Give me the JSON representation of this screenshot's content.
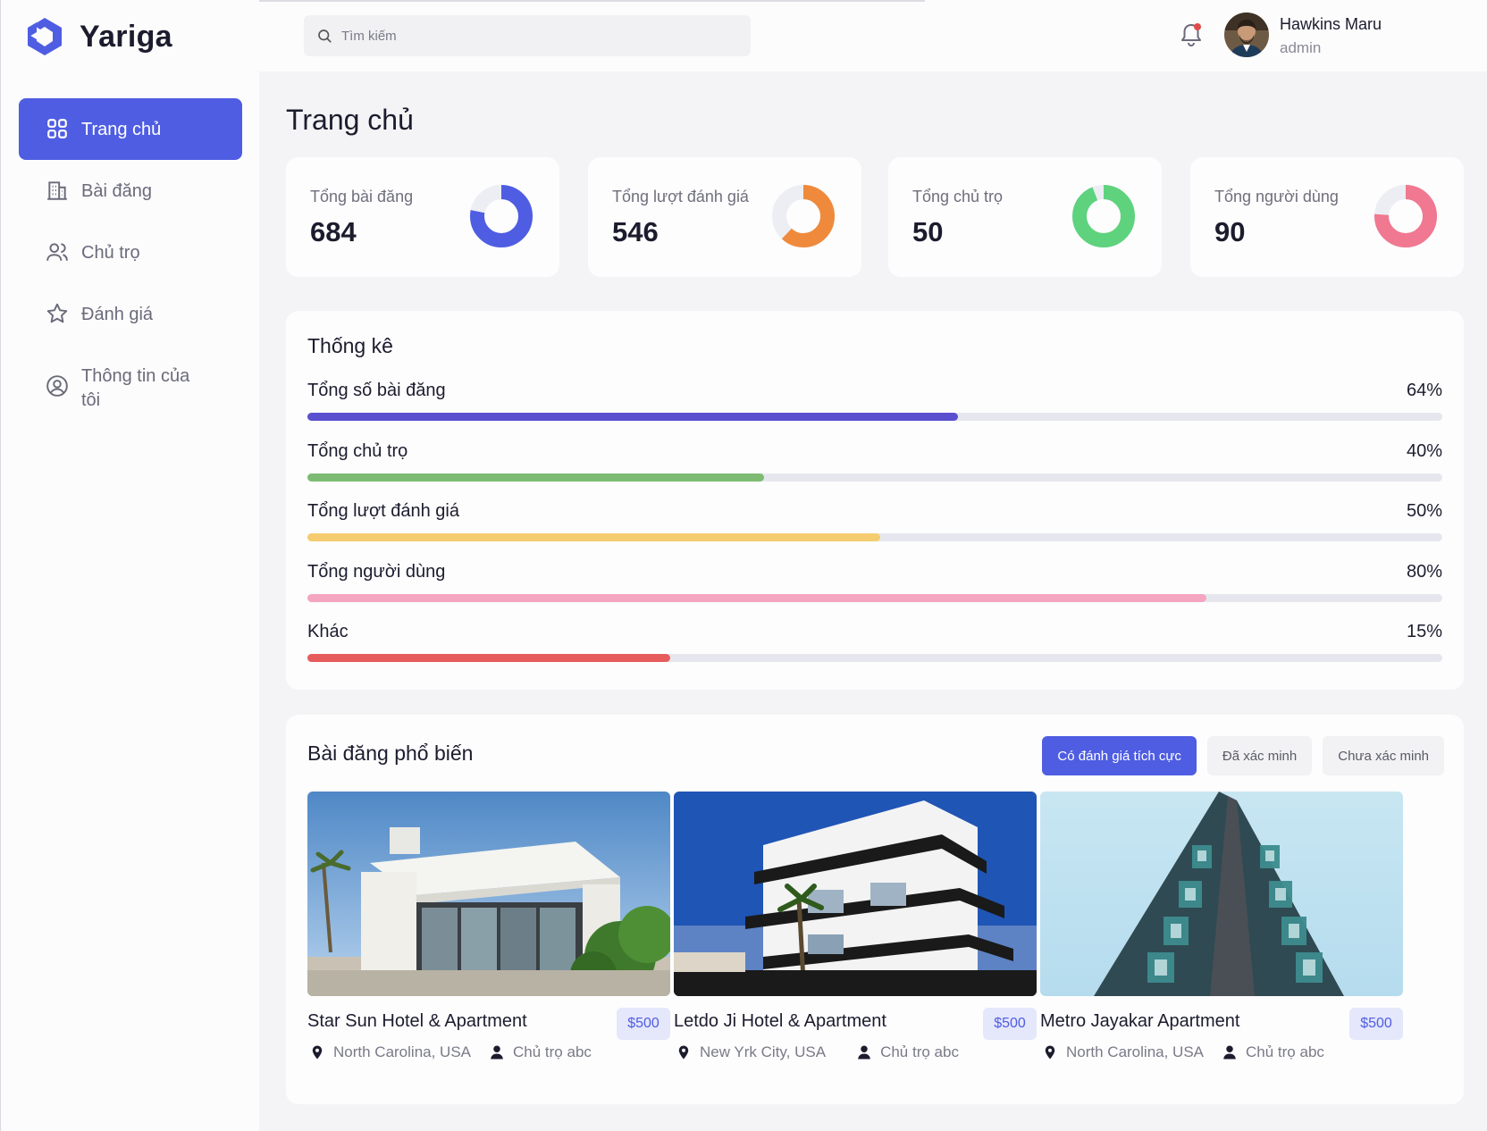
{
  "app": {
    "name": "Yariga"
  },
  "sidebar": {
    "items": [
      {
        "label": "Trang chủ",
        "icon": "dashboard-grid-icon",
        "active": true
      },
      {
        "label": "Bài đăng",
        "icon": "building-icon"
      },
      {
        "label": "Chủ trọ",
        "icon": "users-icon"
      },
      {
        "label": "Đánh giá",
        "icon": "star-icon"
      },
      {
        "label": "Thông tin của tôi",
        "icon": "user-circle-icon"
      }
    ]
  },
  "header": {
    "search_placeholder": "Tìm kiếm",
    "user_name": "Hawkins Maru",
    "user_role": "admin"
  },
  "page": {
    "title": "Trang chủ"
  },
  "stats": [
    {
      "label": "Tổng bài đăng",
      "value": "684",
      "color": "#4f5de2",
      "fraction": 0.78
    },
    {
      "label": "Tổng lượt đánh giá",
      "value": "546",
      "color": "#ef8a3c",
      "fraction": 0.62
    },
    {
      "label": "Tổng chủ trọ",
      "value": "50",
      "color": "#5fd27e",
      "fraction": 0.94
    },
    {
      "label": "Tổng người dùng",
      "value": "90",
      "color": "#f07890",
      "fraction": 0.76
    }
  ],
  "statistics": {
    "title": "Thống kê",
    "rows": [
      {
        "label": "Tổng số bài đăng",
        "percent": "64%",
        "value": 0.573,
        "color": "#5a4fcf"
      },
      {
        "label": "Tổng chủ trọ",
        "percent": "40%",
        "value": 0.402,
        "color": "#7dbb73"
      },
      {
        "label": "Tổng lượt đánh giá",
        "percent": "50%",
        "value": 0.505,
        "color": "#f5cd70"
      },
      {
        "label": "Tổng người dùng",
        "percent": "80%",
        "value": 0.792,
        "color": "#f4a5c0"
      },
      {
        "label": "Khác",
        "percent": "15%",
        "value": 0.32,
        "color": "#e65c5c"
      }
    ]
  },
  "popular": {
    "title": "Bài đăng phổ biến",
    "tabs": [
      "Có đánh giá tích cực",
      "Đã xác minh",
      "Chưa xác minh"
    ],
    "listings": [
      {
        "name": "Star Sun Hotel & Apartment",
        "price": "$500",
        "location": "North Carolina, USA",
        "owner": "Chủ trọ abc"
      },
      {
        "name": "Letdo Ji Hotel & Apartment",
        "price": "$500",
        "location": "New Yrk City, USA",
        "owner": "Chủ trọ abc"
      },
      {
        "name": "Metro Jayakar Apartment",
        "price": "$500",
        "location": "North Carolina, USA",
        "owner": "Chủ trọ abc"
      }
    ]
  }
}
